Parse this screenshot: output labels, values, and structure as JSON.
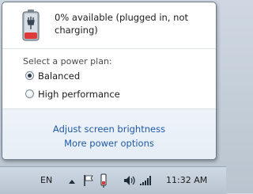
{
  "popup": {
    "status_text": "0% available (plugged in, not charging)",
    "plan_heading": "Select a power plan:",
    "plans": [
      {
        "label": "Balanced",
        "checked": true
      },
      {
        "label": "High performance",
        "checked": false
      }
    ],
    "links": [
      "Adjust screen brightness",
      "More power options"
    ]
  },
  "taskbar": {
    "language": "EN",
    "clock": "11:32 AM",
    "icons": [
      "show-hidden-icons-icon",
      "action-center-flag-icon",
      "power-plug-icon",
      "volume-icon",
      "network-icon"
    ]
  },
  "colors": {
    "link": "#1e5aa8",
    "battery_red": "#e0393a"
  }
}
